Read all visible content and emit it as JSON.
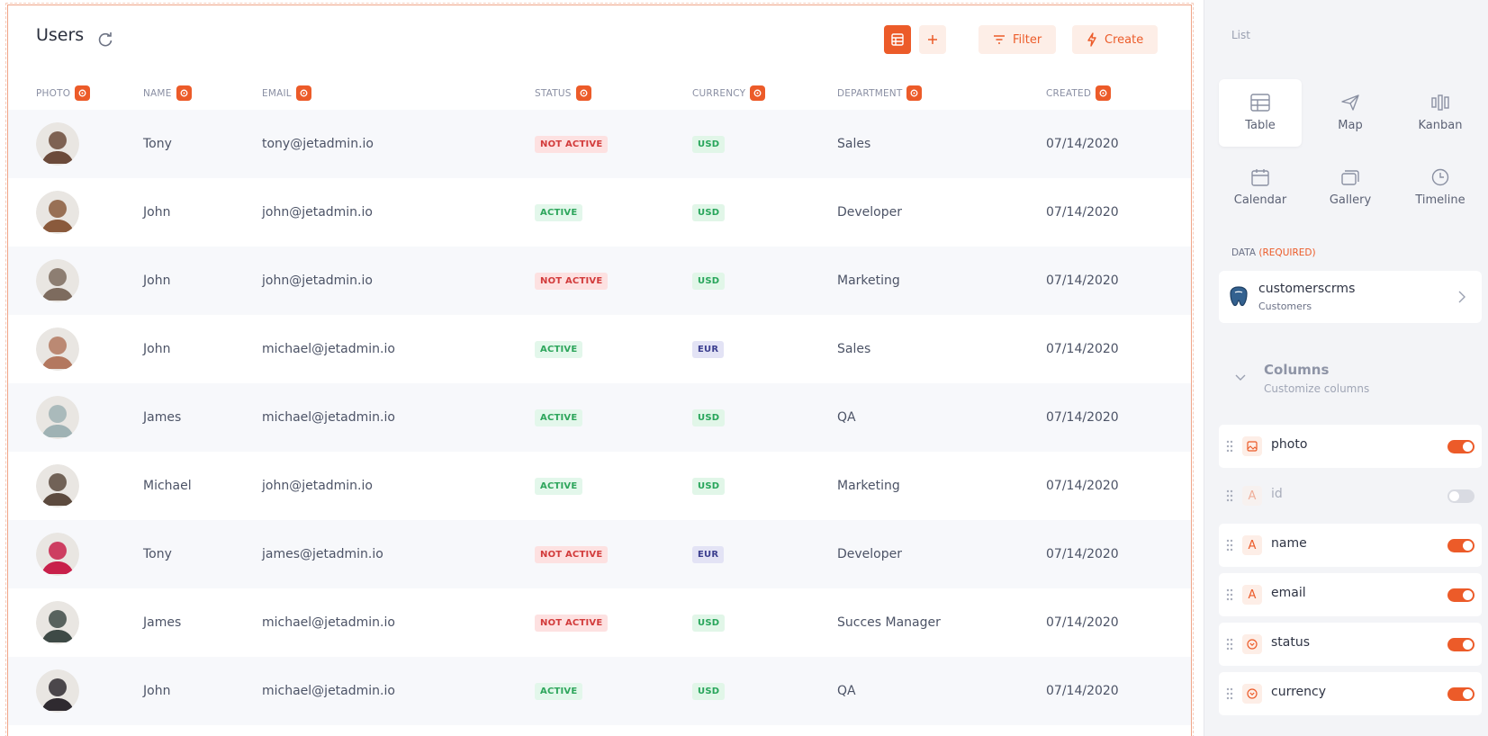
{
  "header": {
    "title": "Users"
  },
  "toolbar": {
    "filter_label": "Filter",
    "create_label": "Create"
  },
  "columns": [
    "PHOTO",
    "NAME",
    "EMAIL",
    "STATUS",
    "CURRENCY",
    "DEPARTMENT",
    "CREATED"
  ],
  "rows": [
    {
      "name": "Tony",
      "email": "tony@jetadmin.io",
      "status": "NOT ACTIVE",
      "currency": "USD",
      "department": "Sales",
      "created": "07/14/2020",
      "avatar_color": "#6b4a3a"
    },
    {
      "name": "John",
      "email": "john@jetadmin.io",
      "status": "ACTIVE",
      "currency": "USD",
      "department": "Developer",
      "created": "07/14/2020",
      "avatar_color": "#8a5a3c"
    },
    {
      "name": "John",
      "email": "john@jetadmin.io",
      "status": "NOT ACTIVE",
      "currency": "USD",
      "department": "Marketing",
      "created": "07/14/2020",
      "avatar_color": "#7d6b5e"
    },
    {
      "name": "John",
      "email": "michael@jetadmin.io",
      "status": "ACTIVE",
      "currency": "EUR",
      "department": "Sales",
      "created": "07/14/2020",
      "avatar_color": "#b3785f"
    },
    {
      "name": "James",
      "email": "michael@jetadmin.io",
      "status": "ACTIVE",
      "currency": "USD",
      "department": "QA",
      "created": "07/14/2020",
      "avatar_color": "#9fb2b4"
    },
    {
      "name": "Michael",
      "email": "john@jetadmin.io",
      "status": "ACTIVE",
      "currency": "USD",
      "department": "Marketing",
      "created": "07/14/2020",
      "avatar_color": "#5c4a3e"
    },
    {
      "name": "Tony",
      "email": "james@jetadmin.io",
      "status": "NOT ACTIVE",
      "currency": "EUR",
      "department": "Developer",
      "created": "07/14/2020",
      "avatar_color": "#c8204a"
    },
    {
      "name": "James",
      "email": "michael@jetadmin.io",
      "status": "NOT ACTIVE",
      "currency": "USD",
      "department": "Succes Manager",
      "created": "07/14/2020",
      "avatar_color": "#3e4a46"
    },
    {
      "name": "John",
      "email": "michael@jetadmin.io",
      "status": "ACTIVE",
      "currency": "USD",
      "department": "QA",
      "created": "07/14/2020",
      "avatar_color": "#2f2a30"
    }
  ],
  "sidebar": {
    "label": "List",
    "views": [
      "Table",
      "Map",
      "Kanban",
      "Calendar",
      "Gallery",
      "Timeline"
    ],
    "data_label": "DATA",
    "data_required": "(REQUIRED)",
    "datasource": {
      "name": "customerscrms",
      "sub": "Customers"
    },
    "columns_title": "Columns",
    "columns_sub": "Customize columns",
    "column_items": [
      {
        "name": "photo",
        "type": "image",
        "on": true
      },
      {
        "name": "id",
        "type": "text",
        "on": false
      },
      {
        "name": "name",
        "type": "text",
        "on": true
      },
      {
        "name": "email",
        "type": "text",
        "on": true
      },
      {
        "name": "status",
        "type": "select",
        "on": true
      },
      {
        "name": "currency",
        "type": "select",
        "on": true
      }
    ]
  },
  "colors": {
    "accent": "#ec5b29"
  }
}
